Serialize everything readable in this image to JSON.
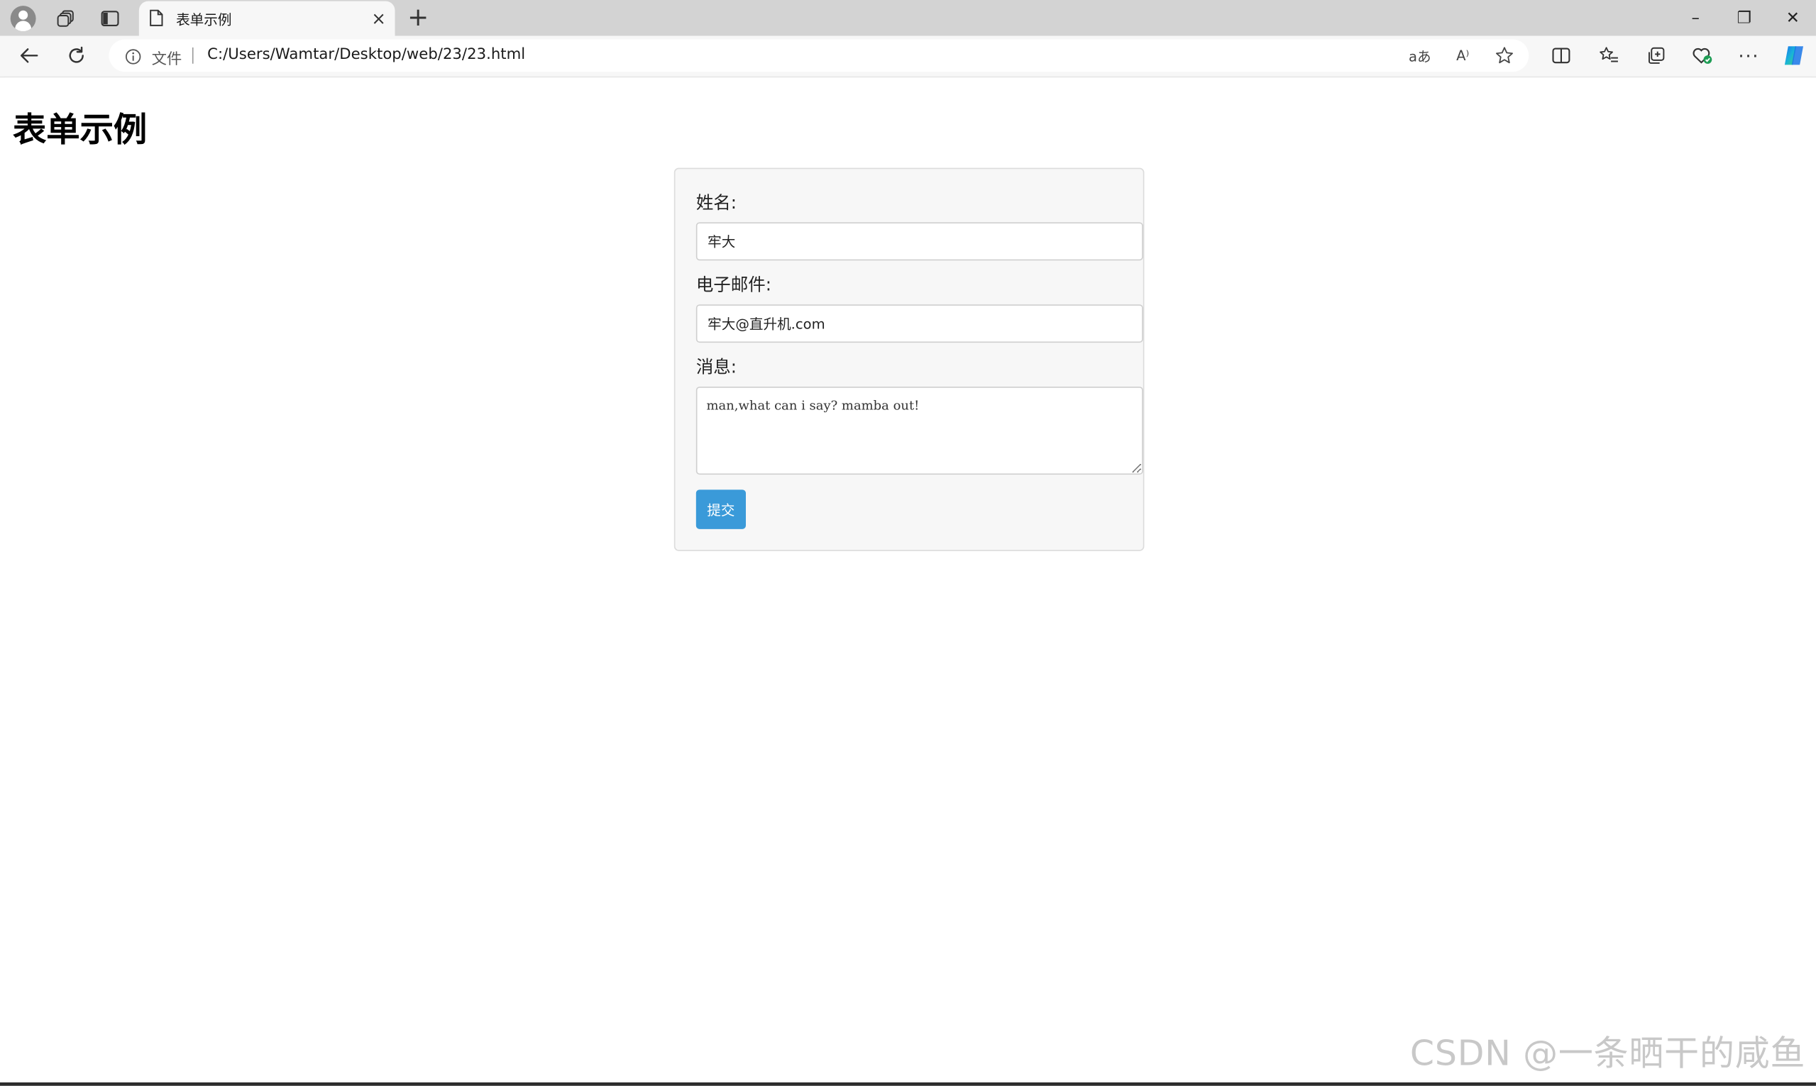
{
  "browser": {
    "tab_title": "表单示例",
    "tab_close_glyph": "×",
    "new_tab_glyph": "+",
    "address_file_label": "文件",
    "url": "C:/Users/Wamtar/Desktop/web/23/23.html",
    "window_controls": {
      "minimize": "–",
      "restore": "❐",
      "close": "✕"
    },
    "icons": [
      "profile-avatar-icon",
      "workspaces-icon",
      "vertical-tabs-icon",
      "page-icon",
      "back-arrow-icon",
      "refresh-icon",
      "site-info-icon",
      "translate-icon",
      "read-aloud-icon",
      "favorite-star-icon",
      "split-screen-icon",
      "favorites-list-icon",
      "collections-icon",
      "browser-essentials-icon",
      "more-menu-icon",
      "copilot-icon"
    ],
    "toolbar_text": {
      "translate": "aあ",
      "read_aloud": "A⁾",
      "more": "···"
    }
  },
  "page": {
    "heading": "表单示例",
    "form": {
      "name_label": "姓名:",
      "name_value": "牢大",
      "email_label": "电子邮件:",
      "email_value": "牢大@直升机.com",
      "message_label": "消息:",
      "message_value": "man,what can i say? mamba out!",
      "submit_label": "提交"
    },
    "accent_color": "#3a9ad9",
    "watermark": "CSDN @一条晒干的咸鱼"
  }
}
